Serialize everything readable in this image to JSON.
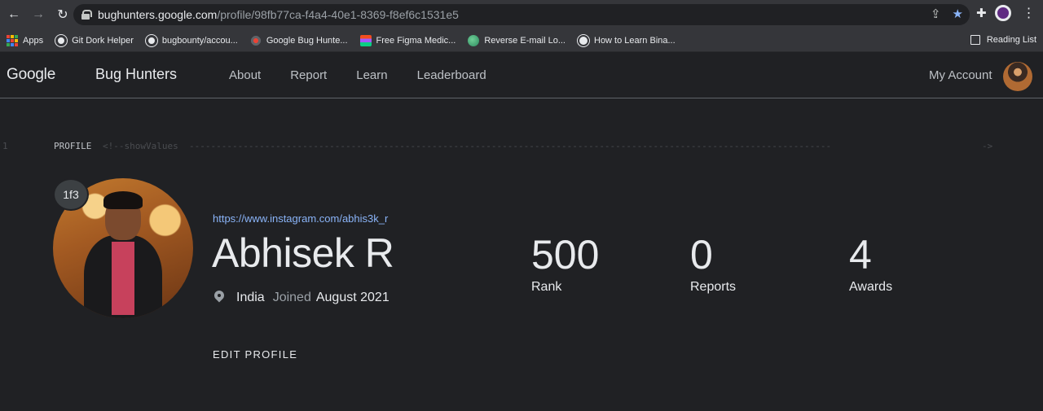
{
  "browser": {
    "url_host": "bughunters.google.com",
    "url_path": "/profile/98fb77ca-f4a4-40e1-8369-f8ef6c1531e5",
    "bookmarks": [
      {
        "label": "Apps",
        "icon": "apps-grid-icon"
      },
      {
        "label": "Git Dork Helper",
        "icon": "github-icon"
      },
      {
        "label": "bugbounty/accou...",
        "icon": "github-icon"
      },
      {
        "label": "Google Bug Hunte...",
        "icon": "bug-hunters-icon"
      },
      {
        "label": "Free Figma Medic...",
        "icon": "figma-icon"
      },
      {
        "label": "Reverse E-mail Lo...",
        "icon": "globe-icon"
      },
      {
        "label": "How to Learn Bina...",
        "icon": "globe-icon"
      }
    ],
    "reading_list": "Reading List"
  },
  "header": {
    "logo": "Google",
    "product": "Bug Hunters",
    "nav": [
      "About",
      "Report",
      "Learn",
      "Leaderboard"
    ],
    "account": "My Account"
  },
  "code": {
    "line_number": "1",
    "keyword": "PROFILE",
    "comment": "<!--showValues",
    "dashes": "-----------------------------------------------------------------------------------------------------------------------",
    "end": "->"
  },
  "profile": {
    "badge": "1f3",
    "link": "https://www.instagram.com/abhis3k_r",
    "name": "Abhisek R",
    "country": "India",
    "joined_label": "Joined",
    "joined": "August 2021",
    "edit": "EDIT PROFILE",
    "stats": [
      {
        "value": "500",
        "label": "Rank"
      },
      {
        "value": "0",
        "label": "Reports"
      },
      {
        "value": "4",
        "label": "Awards"
      }
    ]
  },
  "colors": {
    "background": "#202124",
    "link": "#8ab4f8",
    "text": "#e8eaed"
  }
}
